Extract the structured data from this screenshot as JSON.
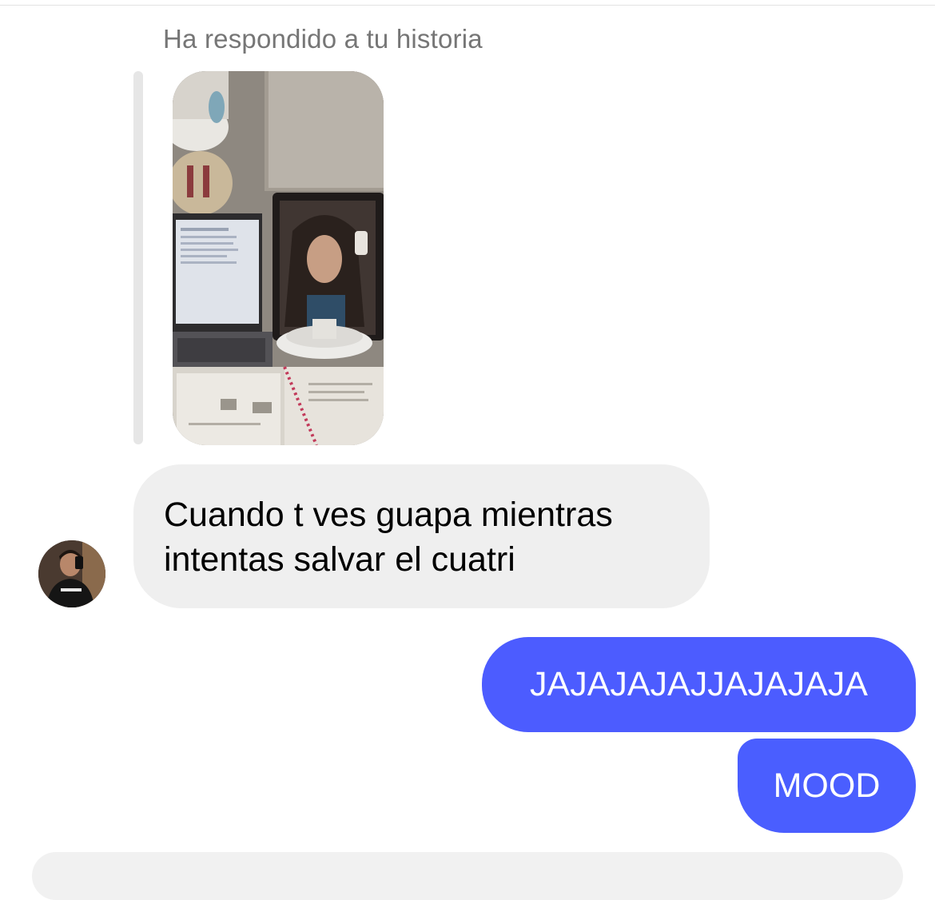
{
  "thread": {
    "story_reply_caption": "Ha respondido a tu historia",
    "messages": [
      {
        "sender": "other",
        "text": "Cuando t ves guapa mientras intentas salvar el cuatri"
      },
      {
        "sender": "me",
        "text": "JAJAJAJAJJAJAJAJA"
      },
      {
        "sender": "me",
        "text": "MOOD"
      }
    ]
  },
  "colors": {
    "incoming_bubble": "#efefef",
    "outgoing_bubble": "#4c5cff",
    "caption_text": "#767676"
  },
  "icons": {
    "avatar": "contact-avatar-photo",
    "story": "story-photo-thumbnail"
  }
}
